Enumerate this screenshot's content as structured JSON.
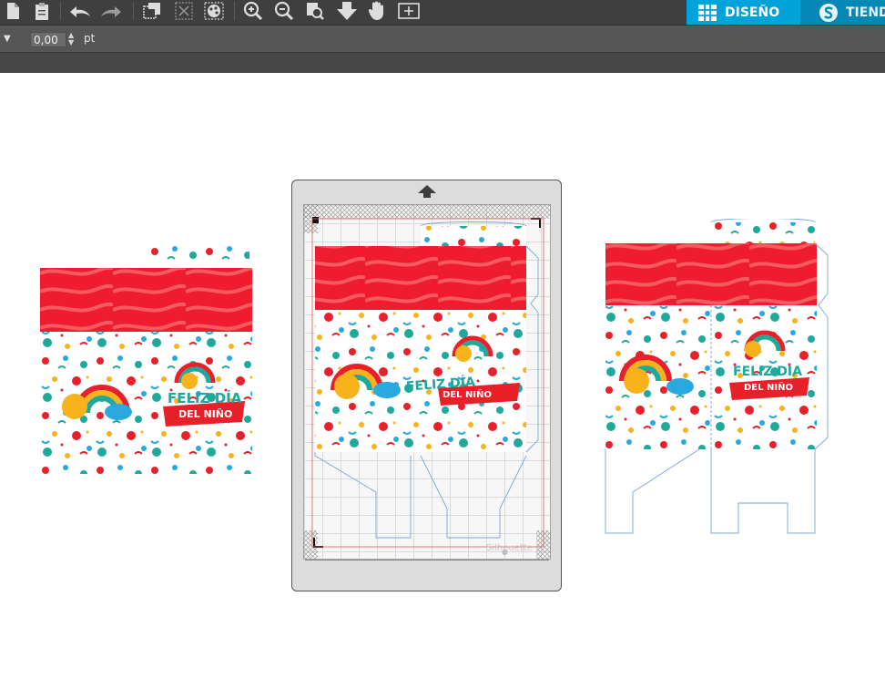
{
  "toolbar": {
    "icons": [
      "page-icon",
      "clipboard-icon",
      "undo-icon",
      "redo-icon",
      "group-icon",
      "ungroup-icon",
      "replicate-icon",
      "zoom-in-icon",
      "zoom-out-icon",
      "zoom-fit-icon",
      "move-down-icon",
      "pan-hand-icon",
      "add-page-icon"
    ],
    "tabs": [
      {
        "label": "DISEÑO",
        "icon": "grid-icon",
        "active": true
      },
      {
        "label": "TIEND",
        "icon": "silhouette-s-icon",
        "active": false
      }
    ]
  },
  "properties": {
    "value": "0,00",
    "unit": "pt"
  },
  "mat": {
    "watermark": "Silhouette"
  },
  "art": {
    "title_line1": "FELIZ DÍA",
    "title_line2": "DEL NIÑO"
  },
  "colors": {
    "toolbar_bg": "#3f3f3f",
    "active_tab": "#00a3d9",
    "banner_red": "#ee1c2e",
    "cut_line": "#7ba4d6"
  }
}
